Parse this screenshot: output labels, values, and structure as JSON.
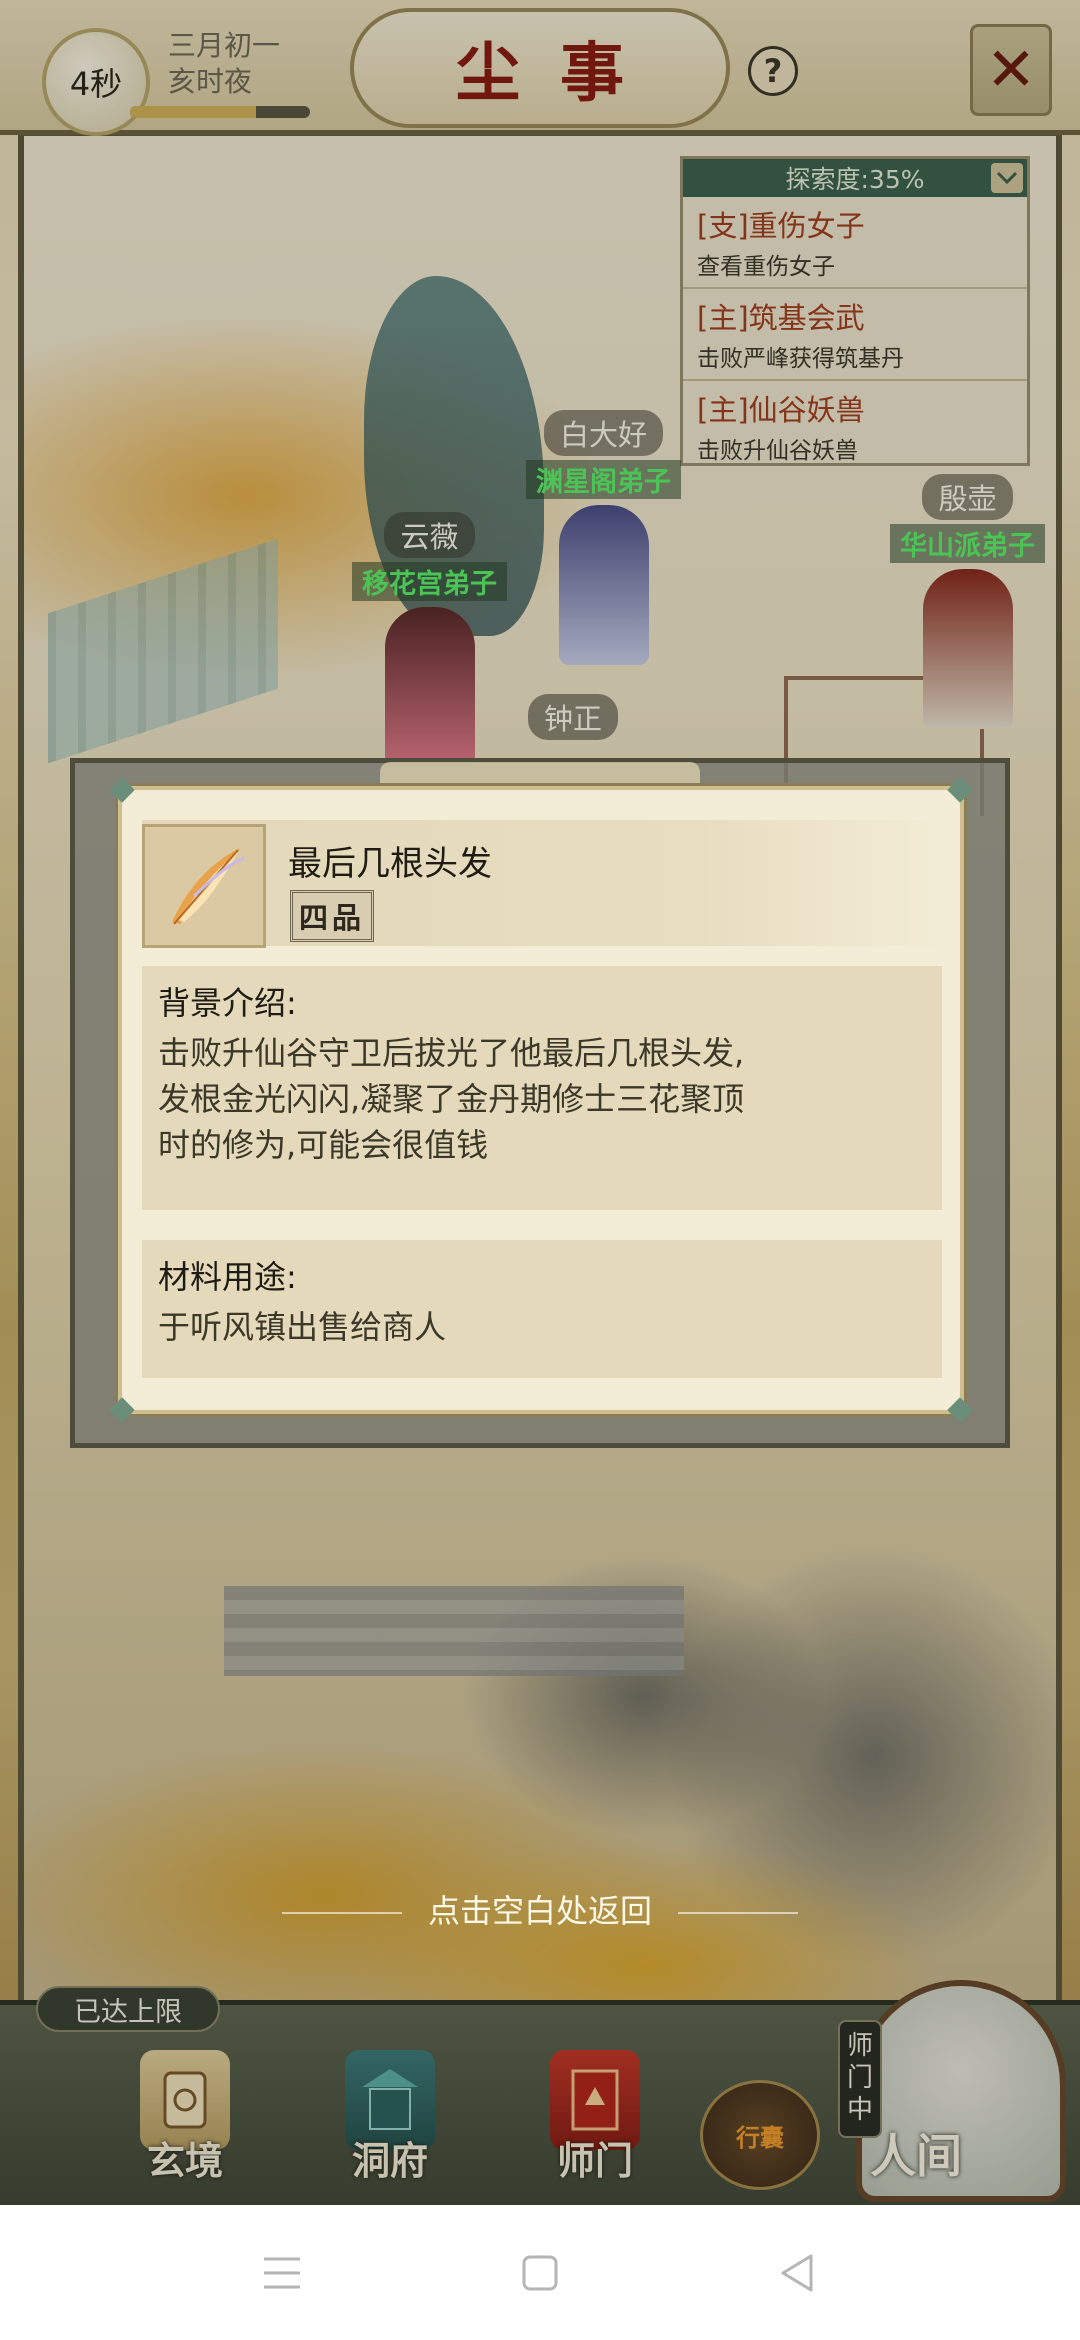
{
  "hud": {
    "timer": "4秒",
    "date_line1": "三月初一",
    "date_line2": "亥时夜",
    "time_progress": 0.7,
    "title": "尘事",
    "help": "?",
    "close": "✕"
  },
  "explore": {
    "header": "探索度:35%",
    "quests": [
      {
        "title": "[支]重伤女子",
        "desc": "查看重伤女子"
      },
      {
        "title": "[主]筑基会武",
        "desc": "击败严峰获得筑基丹"
      },
      {
        "title": "[主]仙谷妖兽",
        "desc": "击败升仙谷妖兽"
      }
    ]
  },
  "npcs": [
    {
      "name": "白大好",
      "faction": "渊星阁弟子"
    },
    {
      "name": "云薇",
      "faction": "移花宫弟子"
    },
    {
      "name": "殷壶",
      "faction": "华山派弟子"
    },
    {
      "name": "钟正",
      "faction": ""
    }
  ],
  "item": {
    "name": "最后几根头发",
    "grade": "四品",
    "background_title": "背景介绍:",
    "background_lines": [
      "击败升仙谷守卫后拔光了他最后几根头发,",
      "发根金光闪闪,凝聚了金丹期修士三花聚顶",
      "时的修为,可能会很值钱"
    ],
    "usage_title": "材料用途:",
    "usage_text": "于听风镇出售给商人"
  },
  "return_hint": "点击空白处返回",
  "bottom": {
    "limit_badge": "已达上限",
    "nav": [
      "玄境",
      "洞府",
      "师门"
    ],
    "bag": "行囊",
    "sect_tag": "师门中",
    "human": "人间"
  },
  "colors": {
    "title_red": "#8a1d12",
    "quest_red": "#a2401e",
    "faction_green": "#5cf06a",
    "panel_green": "#3f6350"
  }
}
